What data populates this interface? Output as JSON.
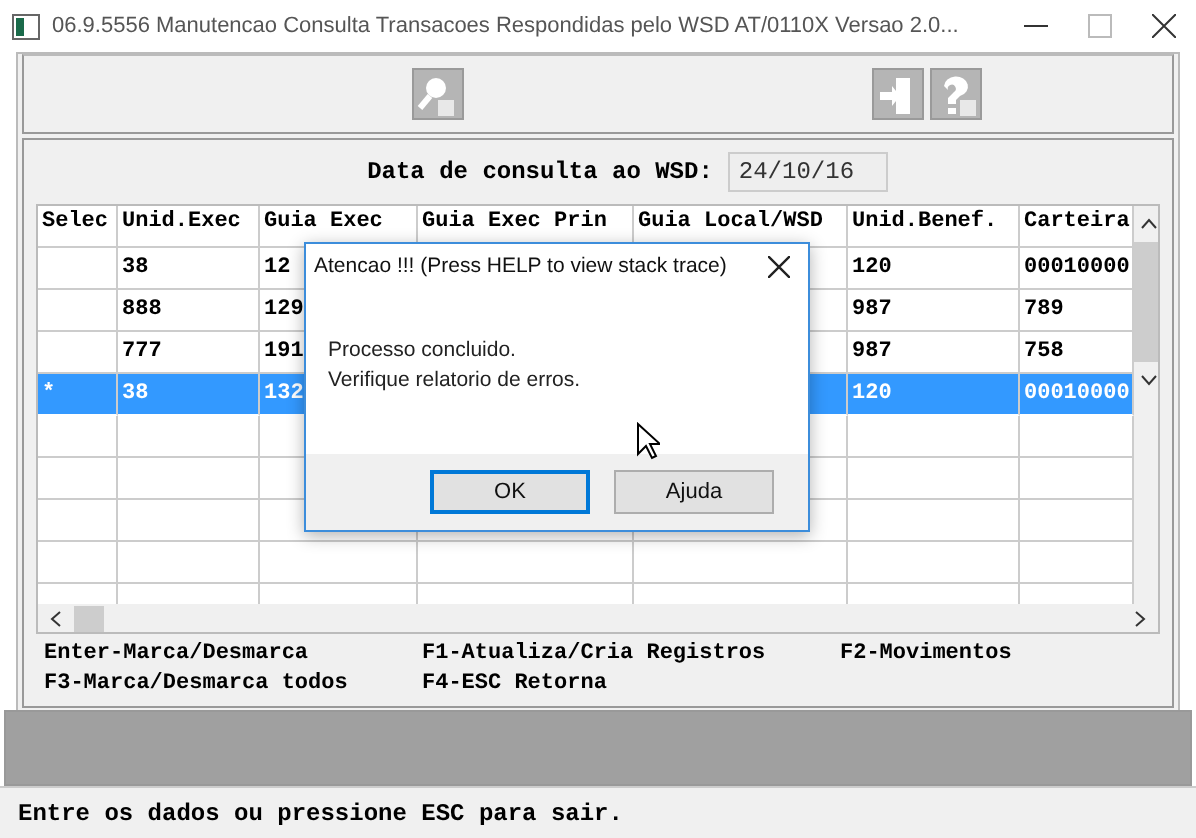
{
  "window": {
    "title": "06.9.5556 Manutencao  Consulta Transacoes Respondidas pelo WSD AT/0110X Versao 2.0..."
  },
  "toolbar": {
    "left": [
      {
        "kind": "key"
      }
    ],
    "right": [
      {
        "kind": "exit"
      },
      {
        "kind": "help"
      }
    ]
  },
  "date_field": {
    "label": "Data de consulta ao WSD:",
    "value": "24/10/16"
  },
  "table": {
    "columns": [
      "Selec",
      "Unid.Exec",
      "Guia Exec",
      "Guia Exec Prin",
      "Guia Local/WSD",
      "Unid.Benef.",
      "Carteira"
    ],
    "rows": [
      {
        "selected": false,
        "cells": [
          null,
          "38",
          "12",
          null,
          null,
          "120",
          "00010000"
        ]
      },
      {
        "selected": false,
        "cells": [
          null,
          "888",
          "129",
          null,
          null,
          "987",
          "789"
        ]
      },
      {
        "selected": false,
        "cells": [
          null,
          "777",
          "191",
          null,
          null,
          "987",
          "758"
        ]
      },
      {
        "selected": true,
        "cells": [
          "*",
          "38",
          "132",
          null,
          null,
          "120",
          "00010000"
        ]
      }
    ]
  },
  "shortcuts": [
    [
      "Enter-Marca/Desmarca",
      "F1-Atualiza/Cria Registros",
      "F2-Movimentos"
    ],
    [
      "F3-Marca/Desmarca todos",
      "F4-ESC Retorna"
    ]
  ],
  "status_bar": "Entre os dados ou pressione ESC para sair.",
  "dialog": {
    "title": "Atencao !!! (Press HELP to view stack trace)",
    "message": [
      "Processo concluido.",
      "Verifique relatorio de erros."
    ],
    "buttons": [
      {
        "label": "OK",
        "default": true
      },
      {
        "label": "Ajuda",
        "default": false
      }
    ]
  }
}
